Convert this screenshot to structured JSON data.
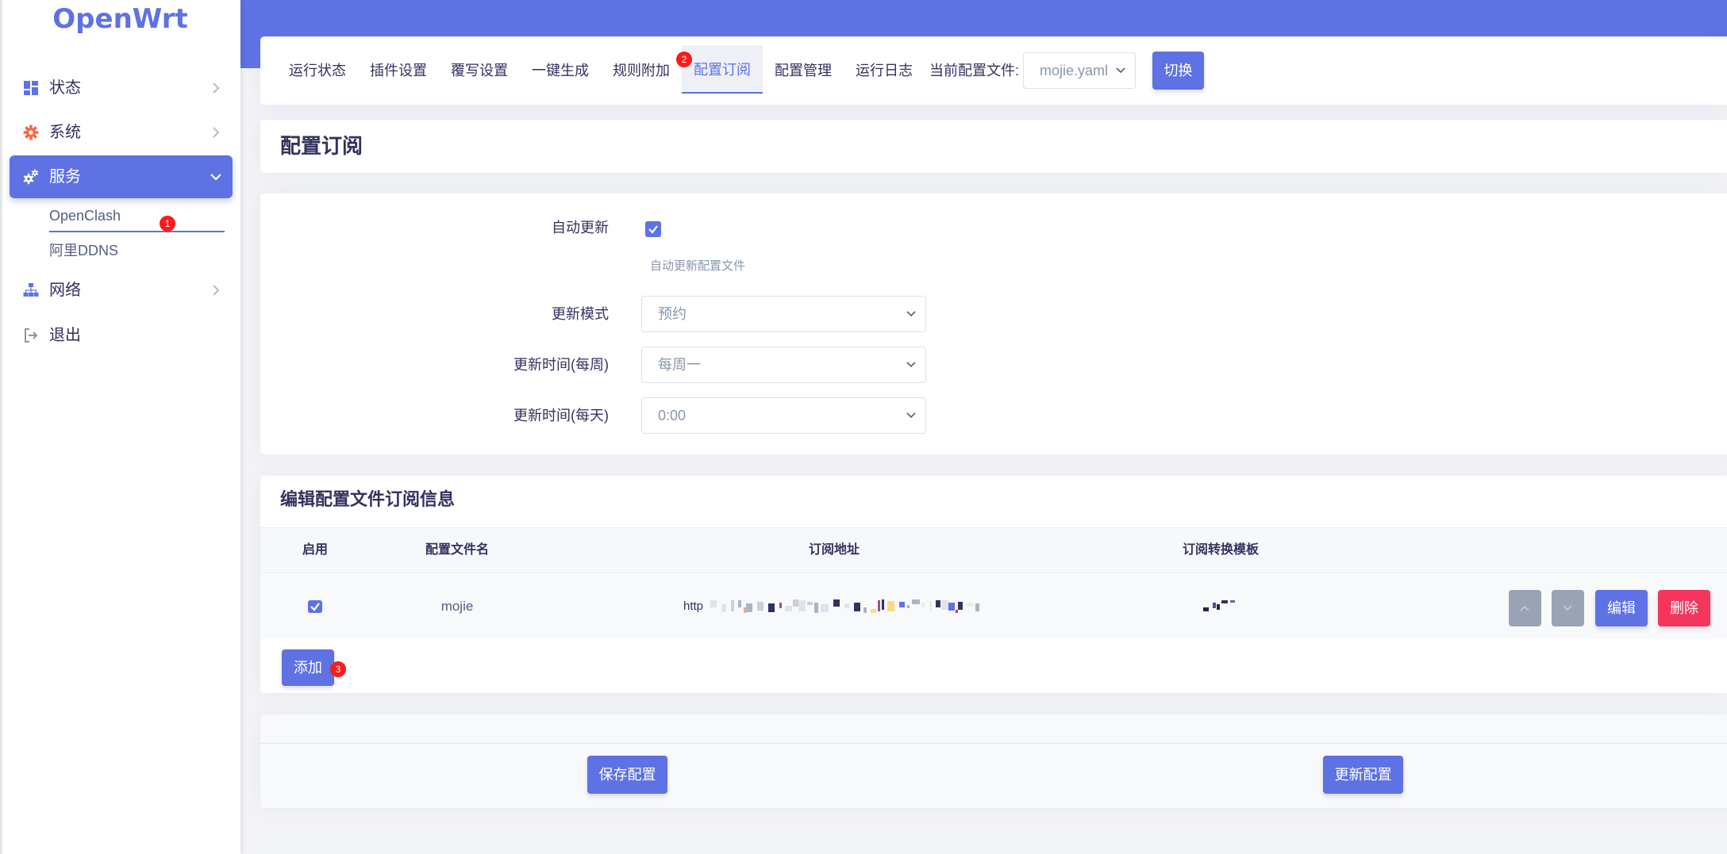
{
  "brand": {
    "logo": "OpenWrt"
  },
  "sidebar": {
    "items": [
      {
        "label": "状态",
        "icon": "dashboard-icon"
      },
      {
        "label": "系统",
        "icon": "gear-icon"
      },
      {
        "label": "服务",
        "icon": "cogs-icon",
        "expanded": true
      },
      {
        "label": "网络",
        "icon": "sitemap-icon"
      },
      {
        "label": "退出",
        "icon": "sign-out-icon"
      }
    ],
    "subitems": [
      {
        "label": "OpenClash",
        "active": true
      },
      {
        "label": "阿里DDNS"
      }
    ]
  },
  "tabs": {
    "items": [
      "运行状态",
      "插件设置",
      "覆写设置",
      "一键生成",
      "规则附加",
      "配置订阅",
      "配置管理",
      "运行日志"
    ],
    "active_index": 5,
    "current_config_label": "当前配置文件:",
    "current_config_value": "mojie.yaml",
    "switch_label": "切换"
  },
  "page": {
    "title": "配置订阅"
  },
  "form": {
    "auto_update": {
      "label": "自动更新",
      "checked": true,
      "help": "自动更新配置文件"
    },
    "update_mode": {
      "label": "更新模式",
      "value": "预约"
    },
    "update_week": {
      "label": "更新时间(每周)",
      "value": "每周一"
    },
    "update_day": {
      "label": "更新时间(每天)",
      "value": "0:00"
    }
  },
  "subscriptions": {
    "title": "编辑配置文件订阅信息",
    "columns": [
      "启用",
      "配置文件名",
      "订阅地址",
      "订阅转换模板"
    ],
    "rows": [
      {
        "enabled": true,
        "name": "mojie",
        "url": "http"
      }
    ],
    "edit_label": "编辑",
    "delete_label": "删除",
    "add_label": "添加"
  },
  "footer": {
    "save_label": "保存配置",
    "update_label": "更新配置"
  },
  "annotation_badges": [
    "1",
    "2",
    "3"
  ],
  "colors": {
    "primary": "#5e72e4",
    "danger": "#f5365c",
    "system_icon": "#fb6340",
    "badge": "#ff1a1a",
    "muted_button": "#98a3b3"
  }
}
